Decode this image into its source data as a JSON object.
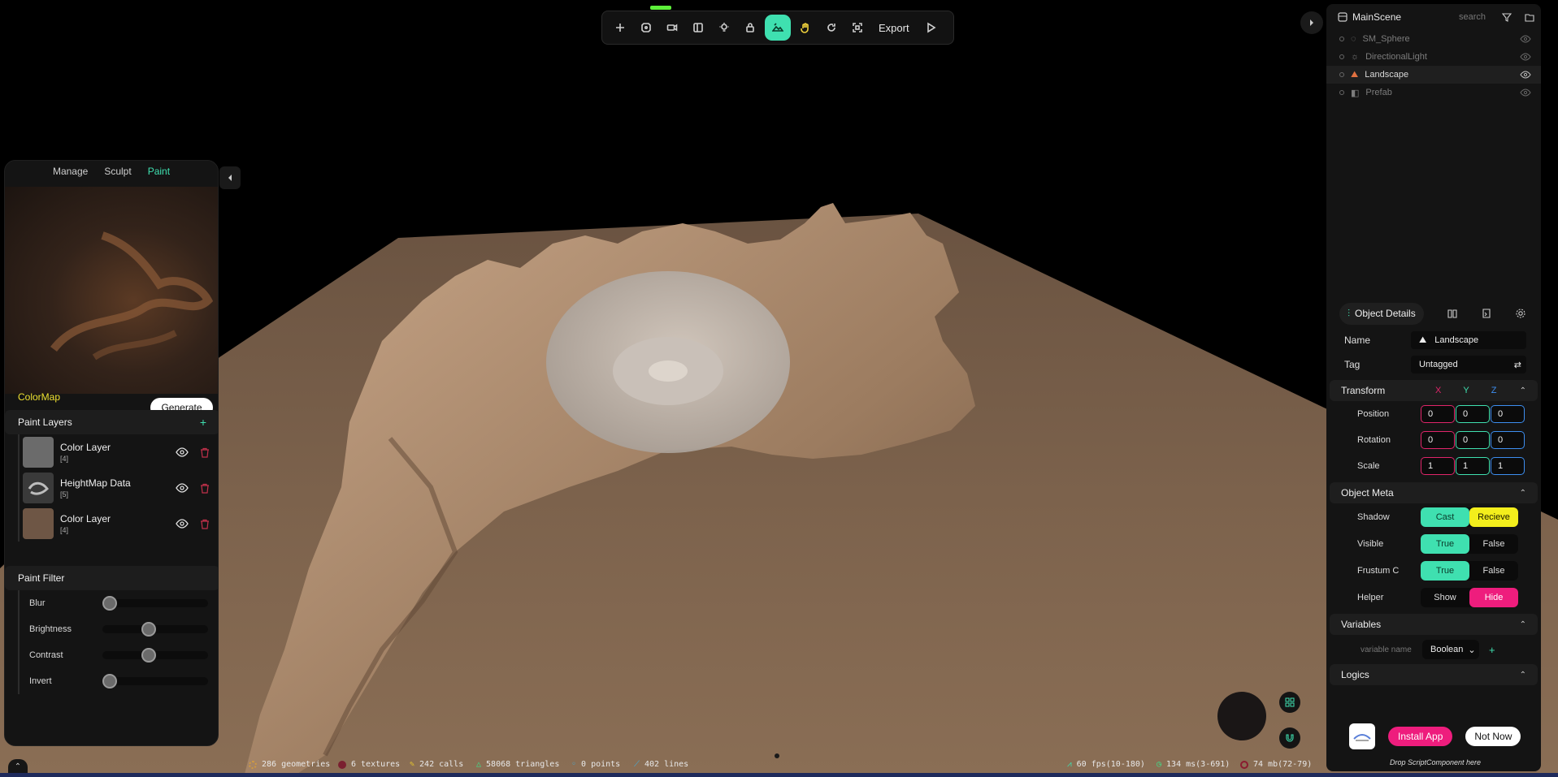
{
  "toolbar": {
    "export_label": "Export",
    "tools": [
      "add-icon",
      "transform-icon",
      "camera-icon",
      "panel-icon",
      "light-icon",
      "lock-icon",
      "terrain-icon",
      "hand-icon",
      "rotate-icon",
      "frame-icon"
    ]
  },
  "left_panel": {
    "tabs": [
      "Manage",
      "Sculpt",
      "Paint"
    ],
    "active_tab": "Paint",
    "colormap_label": "ColorMap",
    "generate_label": "Generate",
    "paint_layers_title": "Paint Layers",
    "layers": [
      {
        "name": "Color Layer",
        "count": "[4]"
      },
      {
        "name": "HeightMap Data",
        "count": "[5]"
      },
      {
        "name": "Color Layer",
        "count": "[4]"
      }
    ],
    "paint_filter_title": "Paint Filter",
    "filters": [
      {
        "label": "Blur",
        "value": 0.0
      },
      {
        "label": "Brightness",
        "value": 0.5
      },
      {
        "label": "Contrast",
        "value": 0.5
      },
      {
        "label": "Invert",
        "value": 0.0
      }
    ]
  },
  "scene": {
    "title": "MainScene",
    "search_placeholder": "search",
    "items": [
      {
        "name": "SM_Sphere",
        "selected": false
      },
      {
        "name": "DirectionalLight",
        "selected": false
      },
      {
        "name": "Landscape",
        "selected": true
      },
      {
        "name": "Prefab",
        "selected": false
      }
    ]
  },
  "details": {
    "tab_label": "Object Details",
    "name_label": "Name",
    "name_value": "Landscape",
    "tag_label": "Tag",
    "tag_value": "Untagged",
    "transform_title": "Transform",
    "axis_x": "X",
    "axis_y": "Y",
    "axis_z": "Z",
    "position_label": "Position",
    "position": [
      "0",
      "0",
      "0"
    ],
    "rotation_label": "Rotation",
    "rotation": [
      "0",
      "0",
      "0"
    ],
    "scale_label": "Scale",
    "scale": [
      "1",
      "1",
      "1"
    ],
    "meta_title": "Object Meta",
    "shadow_label": "Shadow",
    "shadow_cast": "Cast",
    "shadow_receive": "Recieve",
    "visible_label": "Visible",
    "frustum_label": "Frustum C",
    "true_label": "True",
    "false_label": "False",
    "helper_label": "Helper",
    "helper_show": "Show",
    "helper_hide": "Hide",
    "variables_title": "Variables",
    "variable_placeholder": "variable name",
    "variable_type": "Boolean",
    "logics_title": "Logics"
  },
  "install": {
    "install_label": "Install App",
    "not_now_label": "Not Now",
    "drop_hint": "Drop ScriptComponent here"
  },
  "stats": {
    "geometries": "286 geometries",
    "textures": "6 textures",
    "calls": "242 calls",
    "triangles": "58068 triangles",
    "points": "0 points",
    "lines": "402 lines",
    "fps": "60 fps(10-180)",
    "ms": "134 ms(3-691)",
    "mb": "74 mb(72-79)"
  },
  "colors": {
    "accent": "#3fe0b0",
    "pink": "#ee1d7d",
    "yellow": "#f3ee1c",
    "x_axis": "#e0256a",
    "y_axis": "#3fe0b0",
    "z_axis": "#3d8ef0"
  }
}
